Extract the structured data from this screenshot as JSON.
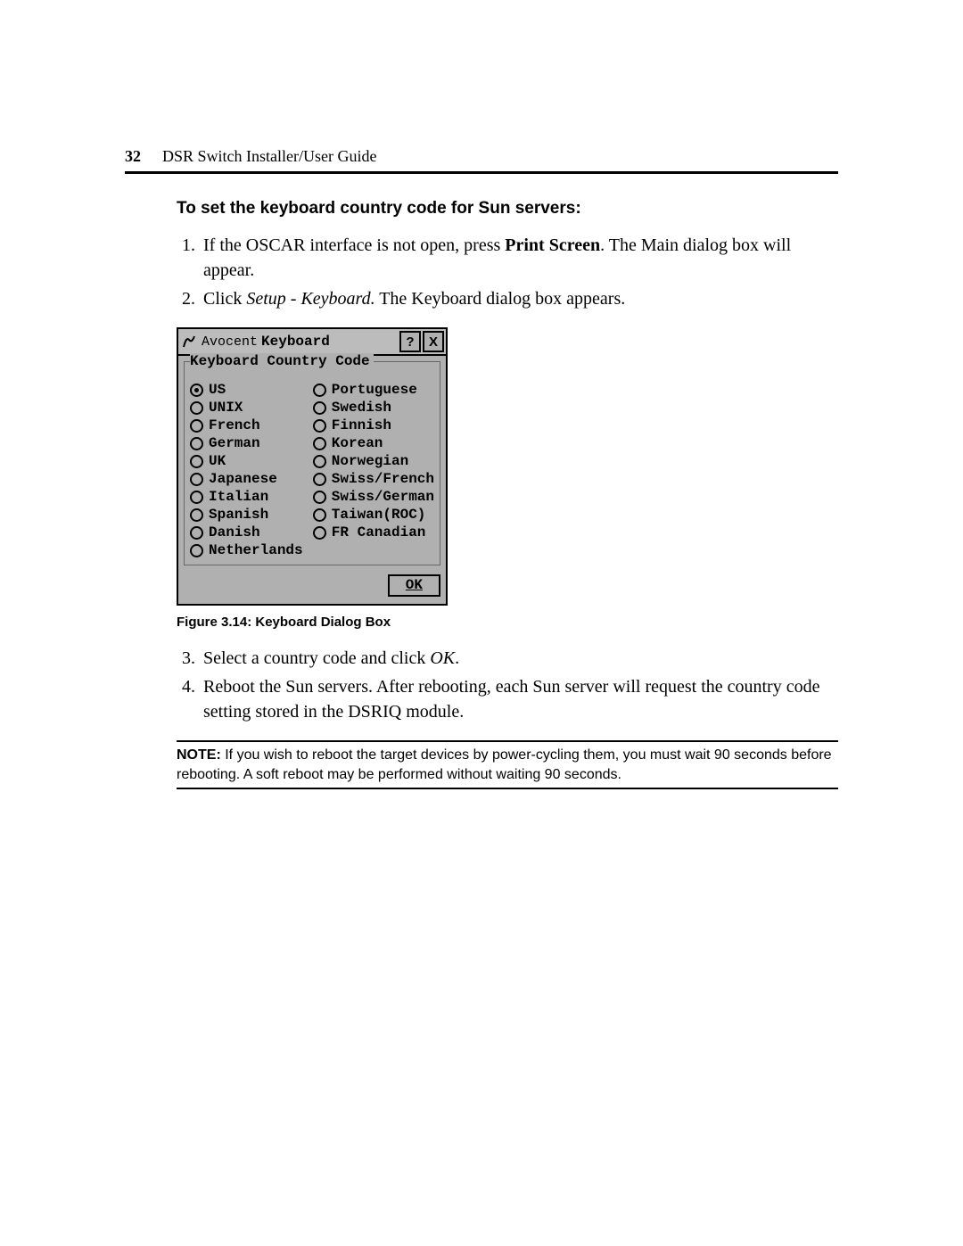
{
  "page": {
    "number": "32",
    "doc_title": "DSR Switch Installer/User Guide"
  },
  "section": {
    "heading": "To set the keyboard country code for Sun servers:"
  },
  "steps_part1": [
    {
      "prefix": "If the OSCAR interface is not open, press ",
      "bold": "Print Screen",
      "suffix": ". The Main dialog box will appear."
    },
    {
      "prefix": "Click ",
      "italic": "Setup - Keyboard.",
      "suffix": " The Keyboard dialog box appears."
    }
  ],
  "dialog": {
    "brand": "Avocent",
    "title": "Keyboard",
    "help_label": "?",
    "close_label": "X",
    "legend": "Keyboard Country Code",
    "options_left": [
      {
        "label": "US",
        "selected": true
      },
      {
        "label": "UNIX",
        "selected": false
      },
      {
        "label": "French",
        "selected": false
      },
      {
        "label": "German",
        "selected": false
      },
      {
        "label": "UK",
        "selected": false
      },
      {
        "label": "Japanese",
        "selected": false
      },
      {
        "label": "Italian",
        "selected": false
      },
      {
        "label": "Spanish",
        "selected": false
      },
      {
        "label": "Danish",
        "selected": false
      },
      {
        "label": "Netherlands",
        "selected": false
      }
    ],
    "options_right": [
      {
        "label": "Portuguese",
        "selected": false
      },
      {
        "label": "Swedish",
        "selected": false
      },
      {
        "label": "Finnish",
        "selected": false
      },
      {
        "label": "Korean",
        "selected": false
      },
      {
        "label": "Norwegian",
        "selected": false
      },
      {
        "label": "Swiss/French",
        "selected": false
      },
      {
        "label": "Swiss/German",
        "selected": false
      },
      {
        "label": "Taiwan(ROC)",
        "selected": false
      },
      {
        "label": "FR Canadian",
        "selected": false
      }
    ],
    "ok_label": "OK"
  },
  "figure_caption": "Figure 3.14: Keyboard Dialog Box",
  "steps_part2": [
    {
      "prefix": "Select a country code and click ",
      "italic": "OK",
      "suffix": "."
    },
    {
      "prefix": "Reboot the Sun servers. After rebooting, each Sun server will request the country code setting stored in the DSRIQ module.",
      "italic": "",
      "suffix": ""
    }
  ],
  "note": {
    "label": "NOTE:",
    "text": " If you wish to reboot the target devices by power-cycling them, you must wait 90 seconds before rebooting. A soft reboot may be performed without waiting 90 seconds."
  }
}
